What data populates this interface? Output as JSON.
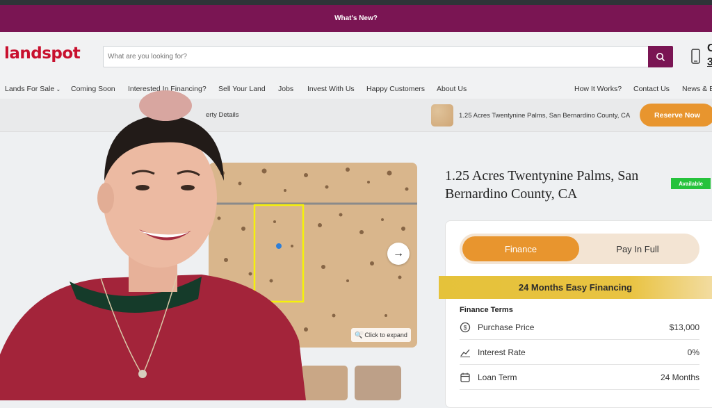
{
  "banner": {
    "text": "What's New?"
  },
  "header": {
    "logo": "landspot",
    "search_placeholder": "What are you looking for?",
    "phone_partial_top": "C",
    "phone_partial_bottom": "3"
  },
  "nav": {
    "items": [
      "Lands For Sale",
      "Coming Soon",
      "Interested In Financing?",
      "Sell Your Land",
      "Jobs",
      "Invest With Us",
      "Happy Customers",
      "About Us"
    ],
    "right_items": [
      "How It Works?",
      "Contact Us",
      "News & B"
    ]
  },
  "subbar": {
    "crumb": "erty Details",
    "property": "1.25 Acres Twentynine Palms, San Bernardino County, CA",
    "reserve": "Reserve Now"
  },
  "gallery": {
    "expand": "Click to expand"
  },
  "listing": {
    "title": "1.25 Acres Twentynine Palms, San Bernardino County, CA",
    "status": "Available",
    "tabs": {
      "finance": "Finance",
      "pay_in_full": "Pay In Full"
    },
    "promo": "24 Months Easy Financing",
    "terms_title": "Finance Terms",
    "terms": [
      {
        "icon": "dollar-icon",
        "label": "Purchase Price",
        "value": "$13,000"
      },
      {
        "icon": "chart-line-icon",
        "label": "Interest Rate",
        "value": "0%"
      },
      {
        "icon": "calendar-icon",
        "label": "Loan Term",
        "value": "24 Months"
      }
    ]
  },
  "colors": {
    "brand": "#7a1553",
    "accent": "#e8952e",
    "logo": "#c8102e",
    "available": "#25c23c"
  }
}
